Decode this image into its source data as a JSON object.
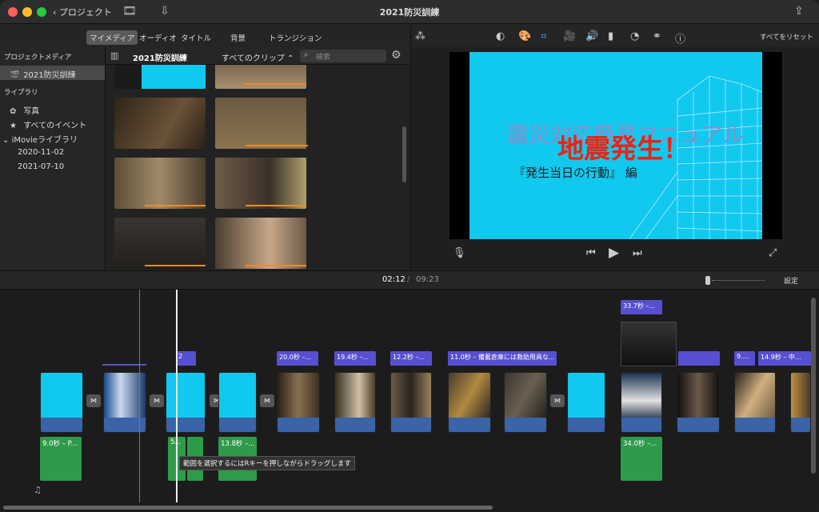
{
  "window": {
    "title": "2021防災訓練",
    "back_label": "プロジェクト"
  },
  "colors": {
    "accent_blue": "#3a63a8",
    "purple_label": "#5650d0",
    "green_audio": "#2f9a4a",
    "cyan_title": "#11c8ee"
  },
  "tabs": [
    {
      "label": "マイメディア",
      "active": true
    },
    {
      "label": "オーディオ",
      "active": false
    },
    {
      "label": "タイトル",
      "active": false
    },
    {
      "label": "背景",
      "active": false
    },
    {
      "label": "トランジション",
      "active": false
    }
  ],
  "sidebar": {
    "project_media_header": "プロジェクトメディア",
    "project_item": "2021防災訓練",
    "library_header": "ライブラリ",
    "items": [
      {
        "label": "写真",
        "icon": "flower-icon"
      },
      {
        "label": "すべてのイベント",
        "icon": "star-icon"
      }
    ],
    "library_name": "iMovieライブラリ",
    "events": [
      "2020-11-02",
      "2021-07-10"
    ]
  },
  "browser": {
    "event_title": "2021防災訓練",
    "filter": "すべてのクリップ",
    "search_placeholder": "検索"
  },
  "viewer": {
    "reset_label": "すべてをリセット",
    "title_card": {
      "line1": "震災対応簡易マニュアル",
      "red": "地震発生！",
      "sub": "『発生当日の行動』 編"
    }
  },
  "timeline": {
    "current_time": "02:12",
    "separator": "/",
    "total_time": "09:23",
    "settings_label": "設定",
    "tooltip": "範囲を選択するにはRキーを押しながらドラッグします",
    "labels": [
      {
        "text": "2"
      },
      {
        "text": "20.0秒 –..."
      },
      {
        "text": "19.4秒 –..."
      },
      {
        "text": "12.2秒 –..."
      },
      {
        "text": "11.0秒 – 備蓄倉庫には救助用具な..."
      },
      {
        "text": "33.7秒 –..."
      },
      {
        "text": "9...."
      },
      {
        "text": "14.9秒 – 中..."
      }
    ],
    "audio_labels": [
      "9.0秒 – P...",
      "5...",
      "13.8秒 –...",
      "34.0秒 –..."
    ]
  }
}
